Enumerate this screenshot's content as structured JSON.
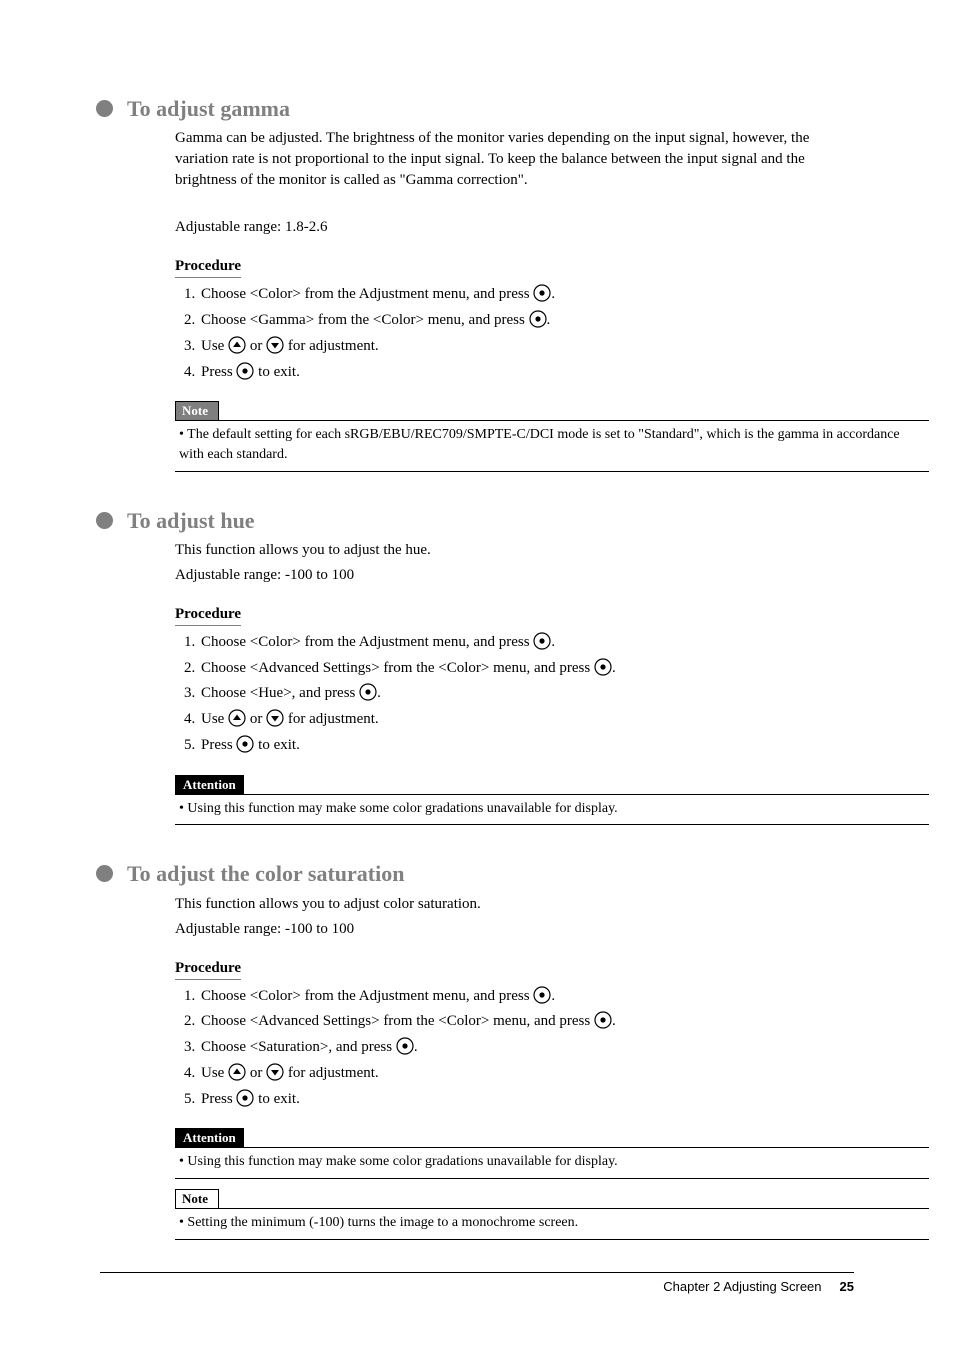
{
  "sections": {
    "gamma": {
      "heading": "To adjust gamma",
      "intro": "Gamma can be adjusted. The brightness of the monitor varies depending on the input signal, however, the variation rate is not proportional to the input signal. To keep the balance between the input signal and the brightness of the monitor is called as \"Gamma correction\".",
      "range": "Adjustable range: 1.8-2.6",
      "procedure_label": "Procedure",
      "steps": {
        "s1": "Choose <Color> from the Adjustment menu, and press ",
        "s1_after": ".",
        "s2": "Choose <Gamma> from the <Color> menu, and press ",
        "s2_after": ".",
        "s3_a": "Use ",
        "s3_b": " or ",
        "s3_c": " for adjustment.",
        "s4_a": "Press ",
        "s4_b": " to exit."
      },
      "note_label": "Note",
      "note_text": "The default setting for each sRGB/EBU/REC709/SMPTE-C/DCI mode is set to \"Standard\", which is the gamma in accordance with each standard."
    },
    "hue": {
      "heading": "To adjust hue",
      "intro": "This function allows you to adjust the hue.",
      "range": "Adjustable range: -100 to 100",
      "procedure_label": "Procedure",
      "steps": {
        "s1": "Choose <Color> from the Adjustment menu, and press ",
        "s1_after": ".",
        "s2": "Choose <Advanced Settings> from the <Color> menu, and press ",
        "s2_after": ".",
        "s3": "Choose <Hue>, and press ",
        "s3_after": ".",
        "s4_a": "Use ",
        "s4_b": " or ",
        "s4_c": " for adjustment.",
        "s5_a": "Press ",
        "s5_b": " to exit."
      },
      "attention_label": "Attention",
      "attention_text": "Using this function may make some color gradations unavailable for display."
    },
    "saturation": {
      "heading": "To adjust the color saturation",
      "intro": "This function allows you to adjust color saturation.",
      "range": "Adjustable range: -100 to 100",
      "procedure_label": "Procedure",
      "steps": {
        "s1": "Choose <Color> from the Adjustment menu, and press ",
        "s1_after": ".",
        "s2": "Choose <Advanced Settings> from the <Color> menu, and press ",
        "s2_after": ".",
        "s3": "Choose <Saturation>, and press ",
        "s3_after": ".",
        "s4_a": "Use ",
        "s4_b": " or ",
        "s4_c": " for adjustment.",
        "s5_a": "Press ",
        "s5_b": " to exit."
      },
      "attention_label": "Attention",
      "attention_text": "Using this function may make some color gradations unavailable for display.",
      "note_label": "Note",
      "note_text": "Setting the minimum (-100) turns the image to a monochrome screen."
    }
  },
  "footer": {
    "chapter": "Chapter 2  Adjusting Screen",
    "page": "25"
  }
}
